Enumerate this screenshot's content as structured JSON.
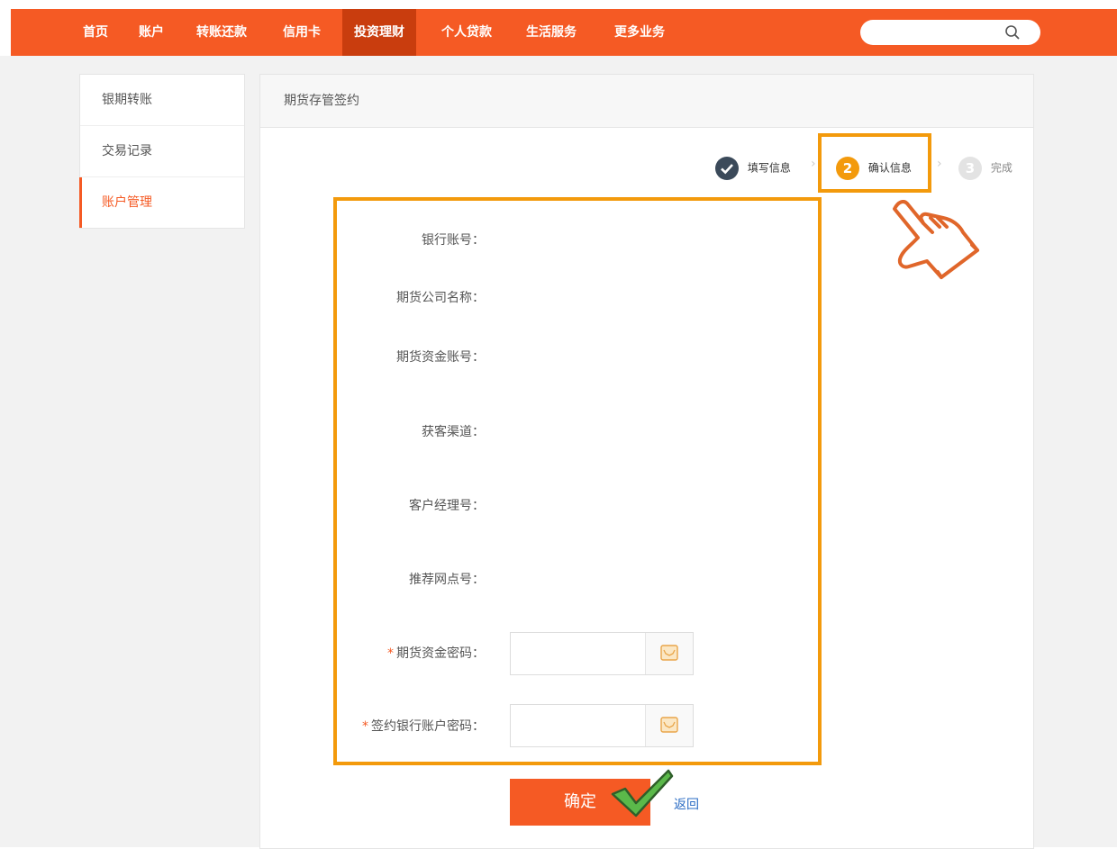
{
  "nav": {
    "items": [
      "首页",
      "账户",
      "转账还款",
      "信用卡",
      "投资理财",
      "个人贷款",
      "生活服务",
      "更多业务"
    ],
    "active": "投资理财"
  },
  "search": {
    "icon": "search-icon"
  },
  "sidebar": {
    "items": [
      "银期转账",
      "交易记录",
      "账户管理"
    ],
    "active": "账户管理"
  },
  "main": {
    "title": "期货存管签约"
  },
  "steps": [
    {
      "number": "1",
      "label": "填写信息",
      "state": "done"
    },
    {
      "number": "2",
      "label": "确认信息",
      "state": "current"
    },
    {
      "number": "3",
      "label": "完成",
      "state": "pending"
    }
  ],
  "form": {
    "fields": [
      {
        "label": "银行账号：",
        "required": false
      },
      {
        "label": "期货公司名称：",
        "required": false
      },
      {
        "label": "期货资金账号：",
        "required": false
      },
      {
        "label": "获客渠道：",
        "required": false
      },
      {
        "label": "客户经理号：",
        "required": false
      },
      {
        "label": "推荐网点号：",
        "required": false
      },
      {
        "label": "期货资金密码：",
        "required": true
      },
      {
        "label": "签约银行账户密码：",
        "required": true
      }
    ],
    "required_mark": "*"
  },
  "actions": {
    "confirm": "确定",
    "back": "返回"
  },
  "colors": {
    "brand": "#f55a24",
    "nav_active": "#c93d0e",
    "highlight": "#f39a0c",
    "link": "#2b6cc4"
  }
}
